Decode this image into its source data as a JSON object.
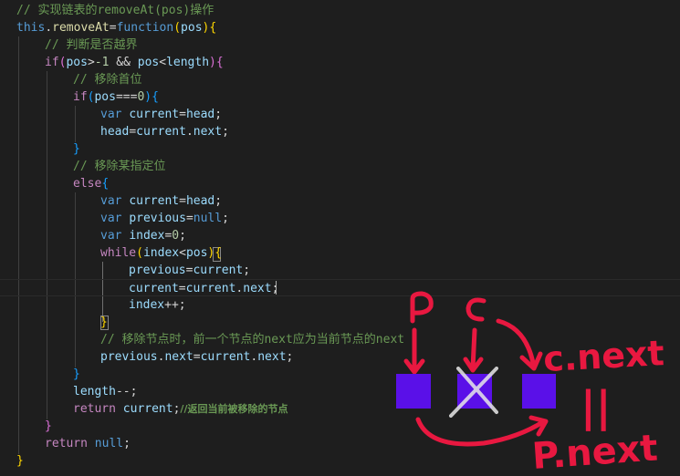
{
  "code": {
    "lines": [
      [
        "// 实现链表的removeAt(pos)操作"
      ],
      [
        "this",
        ".",
        "removeAt",
        "=",
        "function",
        "(",
        "pos",
        ")",
        "{"
      ],
      [
        "// 判断是否越界"
      ],
      [
        "if",
        "(",
        "pos",
        ">",
        "-1",
        " && ",
        "pos",
        "<",
        "length",
        ")",
        "{"
      ],
      [
        "// 移除首位"
      ],
      [
        "if",
        "(",
        "pos",
        "===",
        "0",
        ")",
        "{"
      ],
      [
        "var",
        " ",
        "current",
        "=",
        "head",
        ";"
      ],
      [
        "head",
        "=",
        "current",
        ".",
        "next",
        ";"
      ],
      [
        "}"
      ],
      [
        "// 移除某指定位"
      ],
      [
        "else",
        "{"
      ],
      [
        "var",
        " ",
        "current",
        "=",
        "head",
        ";"
      ],
      [
        "var",
        " ",
        "previous",
        "=",
        "null",
        ";"
      ],
      [
        "var",
        " ",
        "index",
        "=",
        "0",
        ";"
      ],
      [
        "while",
        "(",
        "index",
        "<",
        "pos",
        ")",
        "{"
      ],
      [
        "previous",
        "=",
        "current",
        ";"
      ],
      [
        "current",
        "=",
        "current",
        ".",
        "next",
        ";"
      ],
      [
        "index",
        "++;"
      ],
      [
        "}"
      ],
      [
        "// 移除节点时，前一个节点的next应为当前节点的next"
      ],
      [
        "previous",
        ".",
        "next",
        "=",
        "current",
        ".",
        "next",
        ";"
      ],
      [
        "}"
      ],
      [
        "length",
        "--;"
      ],
      [
        "return",
        " ",
        "current",
        ";",
        "//返回当前被移除的节点"
      ],
      [
        "}"
      ],
      [
        "return",
        " ",
        "null",
        ";"
      ],
      [
        "}"
      ]
    ]
  },
  "annotation": {
    "node_colors": "#5a10e8",
    "ink_color": "#e81840",
    "labels": {
      "p": "P",
      "c": "C",
      "c_next": "c.next",
      "equals": "||",
      "p_next": "P.next"
    }
  }
}
